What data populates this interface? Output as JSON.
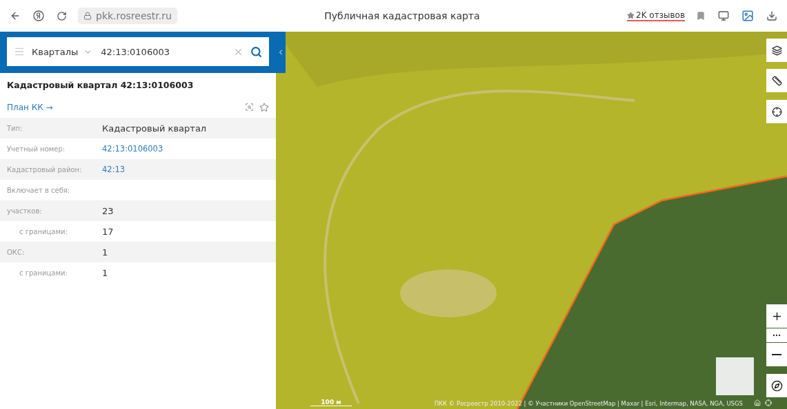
{
  "browser": {
    "url": "pkk.rosreestr.ru",
    "page_title": "Публичная кадастровая карта",
    "reviews": "2K отзывов"
  },
  "search": {
    "layer": "Кварталы",
    "value": "42:13:0106003"
  },
  "panel": {
    "title": "Кадастровый квартал 42:13:0106003",
    "plan_link": "План КК →",
    "rows": [
      {
        "label": "Тип:",
        "value": "Кадастровый квартал",
        "kind": "text"
      },
      {
        "label": "Учетный номер:",
        "value": "42:13:0106003",
        "kind": "link"
      },
      {
        "label": "Кадастровый район:",
        "value": "42:13",
        "kind": "link"
      },
      {
        "label": "Включает в себя:",
        "kind": "heading"
      },
      {
        "label": "участков:",
        "value": "23",
        "kind": "text",
        "children": [
          {
            "label": "с границами:",
            "value": "17",
            "kind": "text"
          }
        ]
      },
      {
        "label": "ОКС:",
        "value": "1",
        "kind": "text",
        "children": [
          {
            "label": "с границами:",
            "value": "1",
            "kind": "text"
          }
        ]
      }
    ]
  },
  "map": {
    "scale": "100 м",
    "attribution": "ПКК © Росреестр 2010-2022 | © Участники OpenStreetMap | Maxar | Esri, Intermap, NASA, NGA, USGS"
  }
}
